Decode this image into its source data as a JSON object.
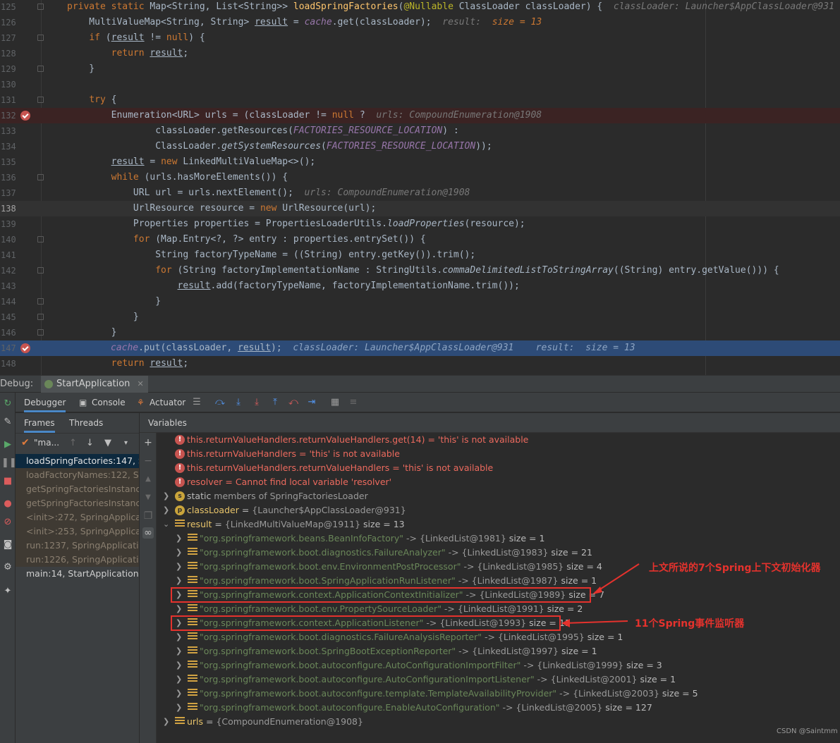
{
  "editor": {
    "lines": [
      {
        "n": "125",
        "html": "<span class='kw'>private static </span>Map&lt;String, List&lt;String&gt;&gt; <span class='fn'>loadSpringFactories</span>(<span class='an'>@Nullable</span> ClassLoader classLoader) {  <span class='hint'>classLoader: Launcher$AppClassLoader@931</span>"
      },
      {
        "n": "126",
        "html": "    MultiValueMap&lt;String, String&gt; <span class='ul'>result</span> = <span class='st'>cache</span>.get(classLoader);  <span class='hint'>result:  </span><span class='hintv'>size = 13</span>"
      },
      {
        "n": "127",
        "html": "    <span class='kw'>if </span>(<span class='ul'>result</span> != <span class='kw'>null</span>) {"
      },
      {
        "n": "128",
        "html": "        <span class='kw'>return </span><span class='ul'>result</span>;"
      },
      {
        "n": "129",
        "html": "    }"
      },
      {
        "n": "130",
        "html": ""
      },
      {
        "n": "131",
        "html": "    <span class='kw'>try </span>{"
      },
      {
        "n": "132",
        "html": "        Enumeration&lt;URL&gt; urls = (classLoader != <span class='kw'>null </span>?  <span class='hint'>urls: CompoundEnumeration@1908</span>"
      },
      {
        "n": "133",
        "html": "                classLoader.getResources(<span class='st'>FACTORIES_RESOURCE_LOCATION</span>) :"
      },
      {
        "n": "134",
        "html": "                ClassLoader.<span class='it'>getSystemResources</span>(<span class='st'>FACTORIES_RESOURCE_LOCATION</span>));"
      },
      {
        "n": "135",
        "html": "        <span class='ul'>result</span> = <span class='kw'>new </span>LinkedMultiValueMap&lt;&gt;();"
      },
      {
        "n": "136",
        "html": "        <span class='kw'>while </span>(urls.hasMoreElements()) {"
      },
      {
        "n": "137",
        "html": "            URL url = urls.nextElement();  <span class='hint'>urls: CompoundEnumeration@1908</span>"
      },
      {
        "n": "138",
        "html": "            UrlResource resource = <span class='kw'>new </span>UrlResource(url);"
      },
      {
        "n": "139",
        "html": "            Properties properties = PropertiesLoaderUtils.<span class='it'>loadProperties</span>(resource);"
      },
      {
        "n": "140",
        "html": "            <span class='kw'>for </span>(Map.Entry&lt;?, ?&gt; entry : properties.entrySet()) {"
      },
      {
        "n": "141",
        "html": "                String factoryTypeName = ((String) entry.getKey()).trim();"
      },
      {
        "n": "142",
        "html": "                <span class='kw'>for </span>(String factoryImplementationName : StringUtils.<span class='it'>commaDelimitedListToStringArray</span>((String) entry.getValue())) {"
      },
      {
        "n": "143",
        "html": "                    <span class='ul'>result</span>.add(factoryTypeName, factoryImplementationName.trim());"
      },
      {
        "n": "144",
        "html": "                }"
      },
      {
        "n": "145",
        "html": "            }"
      },
      {
        "n": "146",
        "html": "        }"
      },
      {
        "n": "147",
        "html": "<span class='st'>cache</span>.put(classLoader, <span class='ul'>result</span>);  <span class='hint'>classLoader: Launcher$AppClassLoader@931    result:  size = 13</span>"
      },
      {
        "n": "148",
        "html": "        <span class='kw'>return </span><span class='ul'>result</span>;"
      }
    ]
  },
  "debug": {
    "label": "Debug:",
    "run_tab": "StartApplication",
    "tabs": {
      "debugger": "Debugger",
      "console": "Console",
      "actuator": "Actuator"
    },
    "frames_tab": "Frames",
    "threads_tab": "Threads",
    "thread_name": "\"ma...",
    "variables_title": "Variables",
    "frames": [
      "loadSpringFactories:147, S",
      "loadFactoryNames:122, Sp",
      "getSpringFactoriesInstanc",
      "getSpringFactoriesInstanc",
      "<init>:272, SpringApplicati",
      "<init>:253, SpringApplicat",
      "run:1237, SpringApplication",
      "run:1226, SpringApplicatio",
      "main:14, StartApplication ("
    ]
  },
  "variables": {
    "errors": [
      {
        "name": "this.returnValueHandlers.returnValueHandlers.get(14)",
        "value": "'this' is not available"
      },
      {
        "name": "this.returnValueHandlers",
        "value": "'this' is not available"
      },
      {
        "name": "this.returnValueHandlers.returnValueHandlers",
        "value": "'this' is not available"
      },
      {
        "name": "resolver",
        "value": "Cannot find local variable 'resolver'"
      }
    ],
    "static_label": "static",
    "static_rest": "members of SpringFactoriesLoader",
    "classLoader": {
      "name": "classLoader",
      "value": "{Launcher$AppClassLoader@931}"
    },
    "result": {
      "name": "result",
      "value": "{LinkedMultiValueMap@1911}",
      "size": "size = 13"
    },
    "entries": [
      {
        "key": "\"org.springframework.beans.BeanInfoFactory\"",
        "ref": "{LinkedList@1981}",
        "size": "size = 1"
      },
      {
        "key": "\"org.springframework.boot.diagnostics.FailureAnalyzer\"",
        "ref": "{LinkedList@1983}",
        "size": "size = 21"
      },
      {
        "key": "\"org.springframework.boot.env.EnvironmentPostProcessor\"",
        "ref": "{LinkedList@1985}",
        "size": "size = 4"
      },
      {
        "key": "\"org.springframework.boot.SpringApplicationRunListener\"",
        "ref": "{LinkedList@1987}",
        "size": "size = 1"
      },
      {
        "key": "\"org.springframework.context.ApplicationContextInitializer\"",
        "ref": "{LinkedList@1989}",
        "size": "size = 7"
      },
      {
        "key": "\"org.springframework.boot.env.PropertySourceLoader\"",
        "ref": "{LinkedList@1991}",
        "size": "size = 2"
      },
      {
        "key": "\"org.springframework.context.ApplicationListener\"",
        "ref": "{LinkedList@1993}",
        "size": "size = 11"
      },
      {
        "key": "\"org.springframework.boot.diagnostics.FailureAnalysisReporter\"",
        "ref": "{LinkedList@1995}",
        "size": "size = 1"
      },
      {
        "key": "\"org.springframework.boot.SpringBootExceptionReporter\"",
        "ref": "{LinkedList@1997}",
        "size": "size = 1"
      },
      {
        "key": "\"org.springframework.boot.autoconfigure.AutoConfigurationImportFilter\"",
        "ref": "{LinkedList@1999}",
        "size": "size = 3"
      },
      {
        "key": "\"org.springframework.boot.autoconfigure.AutoConfigurationImportListener\"",
        "ref": "{LinkedList@2001}",
        "size": "size = 1"
      },
      {
        "key": "\"org.springframework.boot.autoconfigure.template.TemplateAvailabilityProvider\"",
        "ref": "{LinkedList@2003}",
        "size": "size = 5"
      },
      {
        "key": "\"org.springframework.boot.autoconfigure.EnableAutoConfiguration\"",
        "ref": "{LinkedList@2005}",
        "size": "size = 127"
      }
    ],
    "urls": {
      "name": "urls",
      "value": "{CompoundEnumeration@1908}"
    }
  },
  "annotations": {
    "initializers_note": "上文所说的7个Spring上下文初始化器",
    "listeners_note": "11个Spring事件监听器",
    "color": "#e5322d"
  },
  "watermark": "CSDN @Saintmm"
}
